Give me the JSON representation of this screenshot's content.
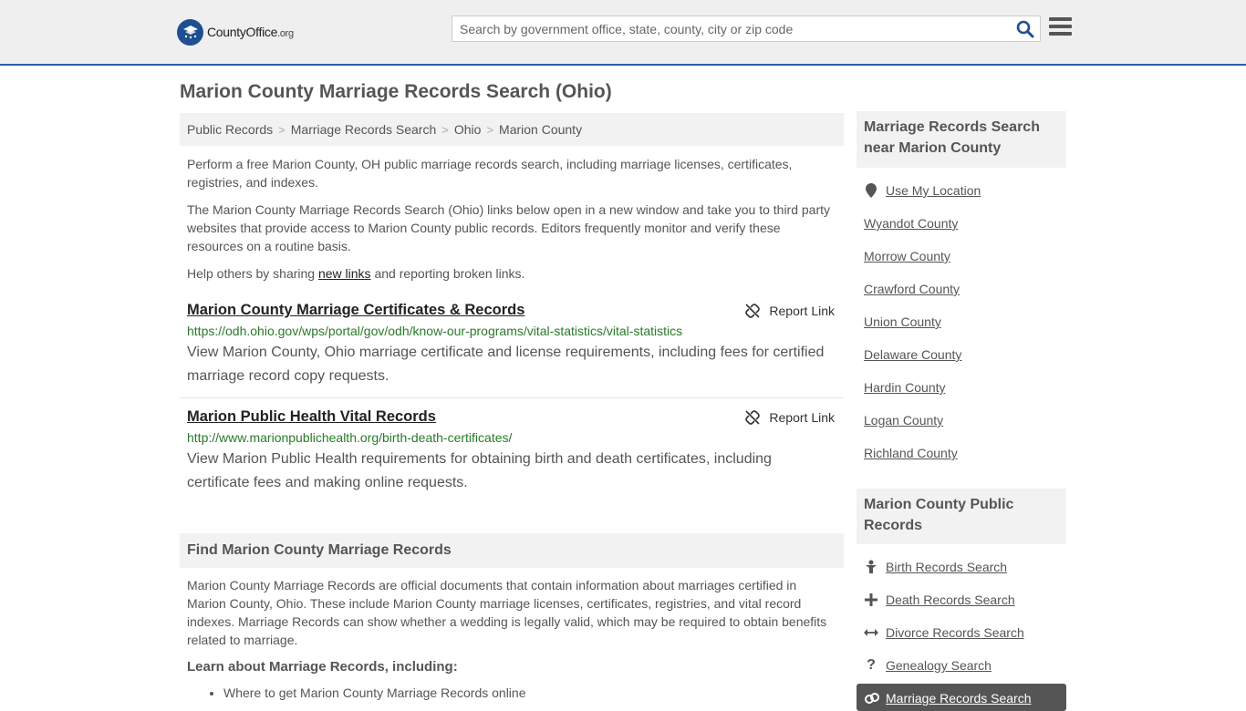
{
  "header": {
    "logo_main": "CountyOffice",
    "logo_tld": ".org",
    "search_placeholder": "Search by government office, state, county, city or zip code"
  },
  "page_title": "Marion County Marriage Records Search (Ohio)",
  "breadcrumb": [
    "Public Records",
    "Marriage Records Search",
    "Ohio",
    "Marion County"
  ],
  "intro": {
    "p1": "Perform a free Marion County, OH public marriage records search, including marriage licenses, certificates, registries, and indexes.",
    "p2": "The Marion County Marriage Records Search (Ohio) links below open in a new window and take you to third party websites that provide access to Marion County public records. Editors frequently monitor and verify these resources on a routine basis.",
    "p3_before": "Help others by sharing ",
    "p3_link": "new links",
    "p3_after": " and reporting broken links."
  },
  "results": [
    {
      "title": "Marion County Marriage Certificates & Records",
      "url": "https://odh.ohio.gov/wps/portal/gov/odh/know-our-programs/vital-statistics/vital-statistics",
      "desc": "View Marion County, Ohio marriage certificate and license requirements, including fees for certified marriage record copy requests.",
      "report": "Report Link"
    },
    {
      "title": "Marion Public Health Vital Records",
      "url": "http://www.marionpublichealth.org/birth-death-certificates/",
      "desc": "View Marion Public Health requirements for obtaining birth and death certificates, including certificate fees and making online requests.",
      "report": "Report Link"
    }
  ],
  "find_section": {
    "heading": "Find Marion County Marriage Records",
    "body": "Marion County Marriage Records are official documents that contain information about marriages certified in Marion County, Ohio. These include Marion County marriage licenses, certificates, registries, and vital record indexes. Marriage Records can show whether a wedding is legally valid, which may be required to obtain benefits related to marriage.",
    "learn_heading": "Learn about Marriage Records, including:",
    "learn_items": [
      "Where to get Marion County Marriage Records online"
    ]
  },
  "sidebar": {
    "nearby_heading": "Marriage Records Search near Marion County",
    "use_location": "Use My Location",
    "nearby": [
      "Wyandot County",
      "Morrow County",
      "Crawford County",
      "Union County",
      "Delaware County",
      "Hardin County",
      "Logan County",
      "Richland County"
    ],
    "public_heading": "Marion County Public Records",
    "public_links": [
      {
        "label": "Birth Records Search",
        "icon": "baby-icon"
      },
      {
        "label": "Death Records Search",
        "icon": "cross-icon"
      },
      {
        "label": "Divorce Records Search",
        "icon": "arrows-icon"
      },
      {
        "label": "Genealogy Search",
        "icon": "question-icon"
      },
      {
        "label": "Marriage Records Search",
        "icon": "rings-icon"
      }
    ]
  },
  "colors": {
    "accent": "#2b5fa8",
    "url_green": "#2a7a2a",
    "active_bg": "#555555"
  }
}
